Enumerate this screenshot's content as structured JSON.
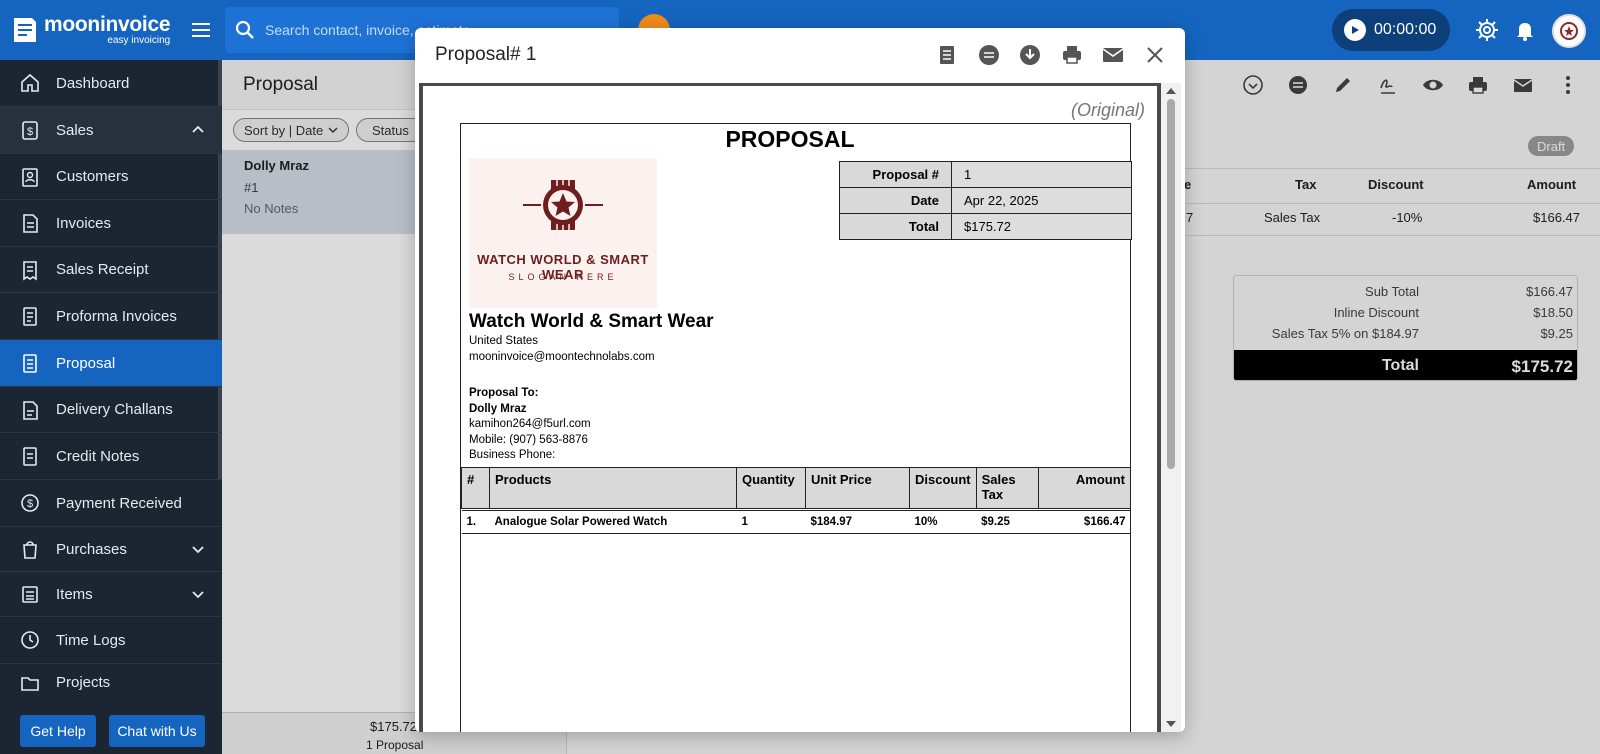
{
  "app": {
    "brand": "mooninvoice",
    "tagline": "easy invoicing",
    "search_placeholder": "Search contact, invoice, estimate",
    "timer": "00:00:00"
  },
  "sidebar": {
    "items": [
      {
        "label": "Dashboard",
        "icon": "home-icon"
      },
      {
        "label": "Sales",
        "icon": "dollar-doc-icon"
      },
      {
        "label": "Customers",
        "icon": "contacts-icon"
      },
      {
        "label": "Invoices",
        "icon": "invoice-icon"
      },
      {
        "label": "Sales Receipt",
        "icon": "receipt-icon"
      },
      {
        "label": "Proforma Invoices",
        "icon": "proforma-icon"
      },
      {
        "label": "Proposal",
        "icon": "proposal-icon"
      },
      {
        "label": "Delivery Challans",
        "icon": "delivery-icon"
      },
      {
        "label": "Credit Notes",
        "icon": "credit-note-icon"
      },
      {
        "label": "Payment Received",
        "icon": "payment-icon"
      },
      {
        "label": "Purchases",
        "icon": "purchases-icon"
      },
      {
        "label": "Items",
        "icon": "items-icon"
      },
      {
        "label": "Time Logs",
        "icon": "clock-icon"
      },
      {
        "label": "Projects",
        "icon": "folder-icon"
      }
    ],
    "help_label": "Get Help",
    "chat_label": "Chat with Us"
  },
  "list": {
    "title": "Proposal",
    "sort_label": "Sort by | Date",
    "status_label": "Status",
    "item": {
      "name": "Dolly Mraz",
      "number": "#1",
      "notes": "No Notes"
    },
    "footer_total": "$175.72",
    "footer_count": "1 Proposal"
  },
  "detail": {
    "status": "Draft",
    "headers": {
      "price_partial": "e",
      "tax": "Tax",
      "discount": "Discount",
      "amount": "Amount"
    },
    "row": {
      "price_partial": "7",
      "tax": "Sales Tax",
      "discount": "-10%",
      "amount": "$166.47"
    },
    "summary": {
      "subtotal_label": "Sub Total",
      "subtotal": "$166.47",
      "inline_label": "Inline Discount",
      "inline": "$18.50",
      "tax_label": "Sales Tax 5% on $184.97",
      "tax": "$9.25",
      "total_label": "Total",
      "total": "$175.72"
    }
  },
  "modal": {
    "title": "Proposal# 1",
    "doc": {
      "original": "(Original)",
      "heading": "PROPOSAL",
      "logo_line1": "WATCH WORLD & SMART WEAR",
      "logo_line2": "SLOGAN HERE",
      "info": {
        "num_label": "Proposal #",
        "num": "1",
        "date_label": "Date",
        "date": "Apr 22, 2025",
        "total_label": "Total",
        "total": "$175.72"
      },
      "business": {
        "name": "Watch World  & Smart Wear",
        "country": "United States",
        "email": "mooninvoice@moontechnolabs.com"
      },
      "to": {
        "label": "Proposal To:",
        "name": "Dolly Mraz",
        "email": "kamihon264@f5url.com",
        "mobile": "Mobile: (907) 563-8876",
        "phone": "Business Phone:"
      },
      "table": {
        "headers": [
          "#",
          "Products",
          "Quantity",
          "Unit Price",
          "Discount",
          "Sales Tax",
          "Amount"
        ],
        "row": [
          "1.",
          "Analogue Solar Powered Watch",
          "1",
          "$184.97",
          "10%",
          "$9.25",
          "$166.47"
        ]
      }
    }
  },
  "colors": {
    "primary": "#1565c0",
    "sidebar_bg": "#1c2632",
    "logo_maroon": "#6e1e1e"
  }
}
